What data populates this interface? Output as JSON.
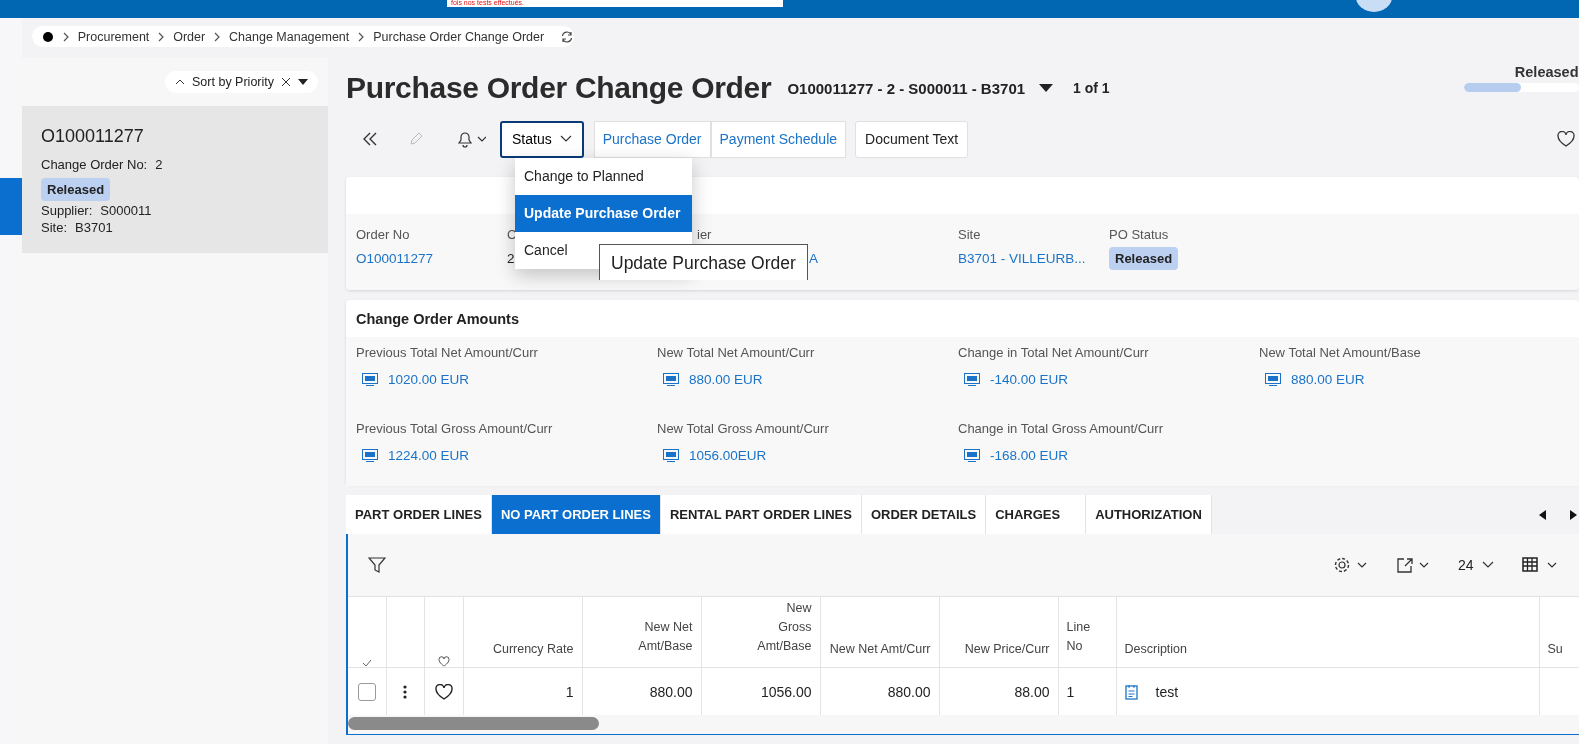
{
  "top_bar": {
    "notice": "fois nos tests effectués."
  },
  "breadcrumb": {
    "items": [
      "Procurement",
      "Order",
      "Change Management",
      "Purchase Order Change Order"
    ]
  },
  "sidebar": {
    "sort": {
      "label": "Sort by Priority"
    },
    "items": [
      {
        "title": "O100011277",
        "change_order_label": "Change Order No:",
        "change_order_no": "2",
        "status": "Released",
        "supplier_label": "Supplier:",
        "supplier": "S000011",
        "site_label": "Site:",
        "site": "B3701",
        "selected": true
      }
    ]
  },
  "header": {
    "title": "Purchase Order Change Order",
    "record": "O100011277 - 2 - S000011 - B3701",
    "pager": "1 of 1",
    "status": {
      "label": "Released",
      "level": 0.5
    }
  },
  "toolbar": {
    "status_menu": {
      "label": "Status",
      "expanded": true,
      "items": [
        {
          "label": "Change to Planned",
          "selected": false
        },
        {
          "label": "Update Purchase Order",
          "selected": true
        },
        {
          "label": "Cancel",
          "selected": false
        }
      ]
    },
    "links": [
      "Purchase Order",
      "Payment Schedule"
    ],
    "buttons": [
      "Document Text"
    ]
  },
  "tooltip": "Update Purchase Order",
  "order_fields": [
    {
      "label": "Order No",
      "value": "O100011277",
      "kind": "link"
    },
    {
      "label": "C",
      "value": "2",
      "kind": "text"
    },
    {
      "label": "ier",
      "value": "A",
      "kind": "link"
    },
    {
      "label": "Site",
      "value": "B3701 - VILLEURB...",
      "kind": "link"
    },
    {
      "label": "PO Status",
      "value": "Released",
      "kind": "badge"
    }
  ],
  "amounts": {
    "title": "Change Order Amounts",
    "fields": [
      {
        "label": "Previous Total Net Amount/Curr",
        "value": "1020.00 EUR"
      },
      {
        "label": "New Total Net Amount/Curr",
        "value": "880.00 EUR"
      },
      {
        "label": "Change in Total Net Amount/Curr",
        "value": "-140.00 EUR"
      },
      {
        "label": "New Total Net Amount/Base",
        "value": "880.00 EUR"
      },
      {
        "label": "Previous Total Gross Amount/Curr",
        "value": "1224.00 EUR"
      },
      {
        "label": "New Total Gross Amount/Curr",
        "value": "1056.00EUR"
      },
      {
        "label": "Change in Total Gross Amount/Curr",
        "value": "-168.00 EUR"
      }
    ]
  },
  "tabs": [
    {
      "label": "PART ORDER LINES",
      "selected": false
    },
    {
      "label": "NO PART ORDER LINES",
      "selected": true
    },
    {
      "label": "RENTAL PART ORDER LINES",
      "selected": false
    },
    {
      "label": "ORDER DETAILS",
      "selected": false
    },
    {
      "label": "CHARGES",
      "selected": false
    },
    {
      "label": "AUTHORIZATION",
      "selected": false
    }
  ],
  "table": {
    "page_size": "24",
    "columns": [
      {
        "label": "Currency Rate",
        "wrap": false
      },
      {
        "label": "New Net Amt/Base",
        "wrap": true
      },
      {
        "label": "New Gross Amt/Base",
        "wrap": true
      },
      {
        "label": "New Net Amt/Curr",
        "wrap": false
      },
      {
        "label": "New Price/Curr",
        "wrap": false
      },
      {
        "label": "Line No",
        "wrap": true
      },
      {
        "label": "Description",
        "wrap": false
      },
      {
        "label": "Su",
        "wrap": false
      }
    ],
    "rows": [
      {
        "checked": false,
        "favorite": false,
        "cells": [
          "1",
          "880.00",
          "1056.00",
          "880.00",
          "88.00",
          "1",
          "test"
        ]
      }
    ]
  }
}
